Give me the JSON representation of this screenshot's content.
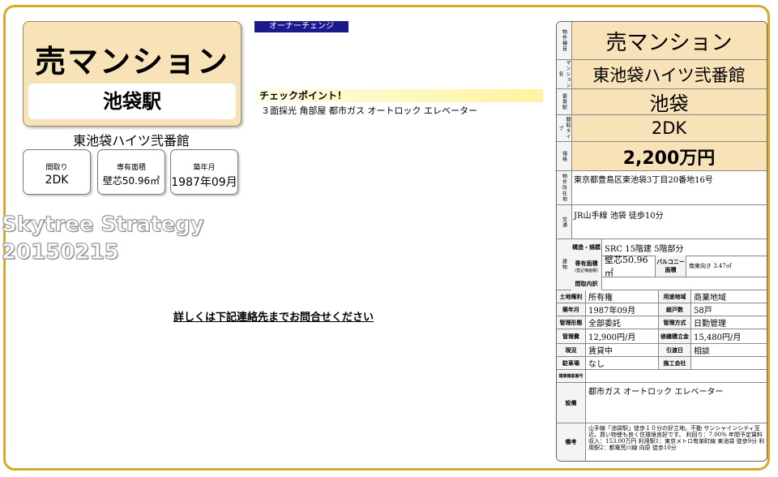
{
  "hero": {
    "title": "売マンション",
    "station": "池袋駅",
    "building": "東池袋ハイツ弐番館"
  },
  "mini": [
    {
      "label": "間取り",
      "value": "2DK"
    },
    {
      "label": "専有面積",
      "value": "壁芯50.96㎡"
    },
    {
      "label": "築年月",
      "value": "1987年09月"
    }
  ],
  "watermark": {
    "line1": "Skytree Strategy",
    "line2": "20150215"
  },
  "owner_badge": "オーナーチェンジ",
  "checkpoint": {
    "title": "チェックポイント！",
    "items": "３面採光 角部屋 都市ガス オートロック エレベーター"
  },
  "contact": "詳しくは下記連絡先までお問合せください",
  "sheet": {
    "type_label": "物件種目",
    "type": "売マンション",
    "name_label": "マンション名",
    "name": "東池袋ハイツ弐番館",
    "station_label": "最寄駅",
    "station": "池袋",
    "layout_label": "間取タイプ",
    "layout": "2DK",
    "price_label": "価格",
    "price": "2,200万円",
    "address_label": "物件所在地",
    "address": "東京都豊島区東池袋3丁目20番地16号",
    "transport_label": "交通",
    "transport": "JR山手線 池袋 徒歩10分",
    "bldg_label": "建物",
    "structure_label": "構造・規模",
    "structure": "SRC 15階建 5階部分",
    "area_label": "専有面積",
    "area_sub": "(登記簿面積)",
    "area": "壁芯50.96㎡",
    "balcony_label": "バルコニー面積",
    "balcony": "南東向き 3.47㎡",
    "layout_detail_label": "間取内訳",
    "layout_detail": "",
    "land_right_label": "土地権利",
    "land_right": "所有権",
    "zoning_label": "用途地域",
    "zoning": "商業地域",
    "built_label": "築年月",
    "built": "1987年09月",
    "units_label": "総戸数",
    "units": "58戸",
    "mgmt_form_label": "管理形態",
    "mgmt_form": "全部委託",
    "mgmt_method_label": "管理方式",
    "mgmt_method": "日勤管理",
    "mgmt_fee_label": "管理費",
    "mgmt_fee": "12,900円/月",
    "repair_label": "修繕積立金",
    "repair": "15,480円/月",
    "status_label": "現況",
    "status": "賃貸中",
    "handover_label": "引渡日",
    "handover": "相談",
    "parking_label": "駐車場",
    "parking": "なし",
    "builder_label": "施工会社",
    "builder": "",
    "contractor_label": "建築確認番号",
    "contractor": "",
    "facilities_label": "設備",
    "facilities": "都市ガス オートロック エレベーター",
    "remarks_label": "備考",
    "remarks": "山手線「池袋駅」徒歩１０分の好立地。不動 サンシャインシティ至近。買い物使も良く住環境良好です。 利回り：7.00% 年間予定賃料収入：153.00万円 利用駅1：東京メトロ有楽町線 東池袋 徒歩9分 利用駅2：都電荒川線 向原 徒歩10分"
  },
  "colors": {
    "frame": "#d9a92a",
    "tan": "#f8e2b7",
    "badge": "#1a1a8c"
  }
}
